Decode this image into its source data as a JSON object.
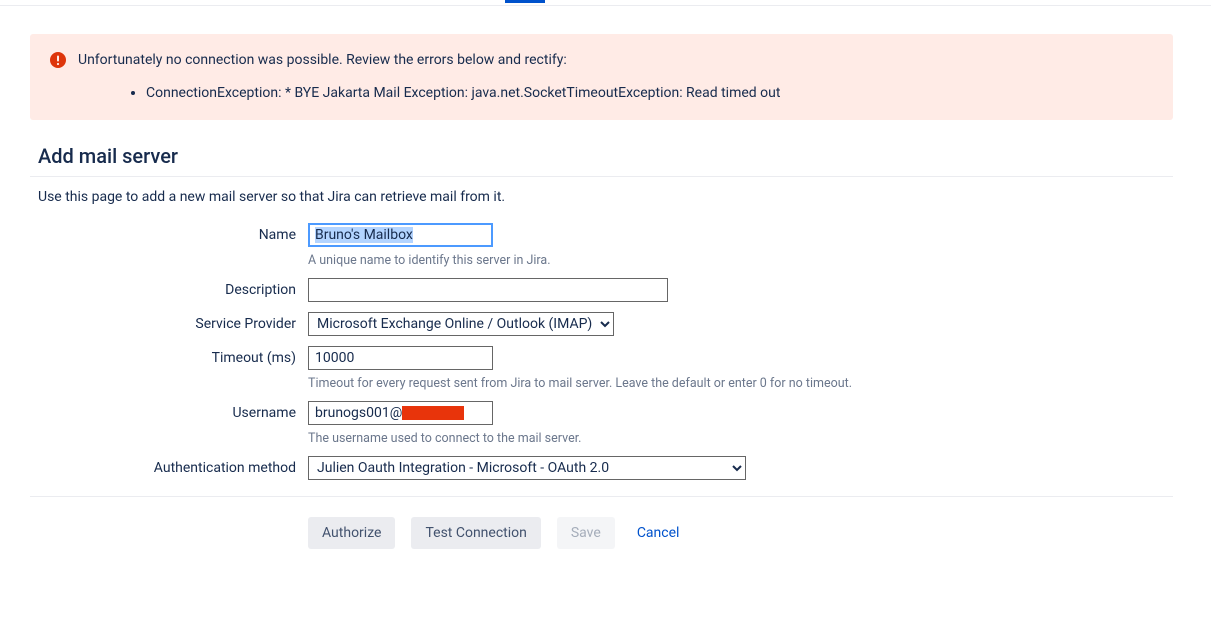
{
  "error": {
    "title": "Unfortunately no connection was possible. Review the errors below and rectify:",
    "items": [
      "ConnectionException: * BYE Jakarta Mail Exception: java.net.SocketTimeoutException: Read timed out"
    ]
  },
  "page": {
    "title": "Add mail server",
    "description": "Use this page to add a new mail server so that Jira can retrieve mail from it."
  },
  "form": {
    "name": {
      "label": "Name",
      "value": "Bruno's Mailbox",
      "help": "A unique name to identify this server in Jira."
    },
    "description": {
      "label": "Description",
      "value": ""
    },
    "service_provider": {
      "label": "Service Provider",
      "value": "Microsoft Exchange Online / Outlook (IMAP)"
    },
    "timeout": {
      "label": "Timeout (ms)",
      "value": "10000",
      "help": "Timeout for every request sent from Jira to mail server. Leave the default or enter 0 for no timeout."
    },
    "username": {
      "label": "Username",
      "value": "brunogs001@",
      "help": "The username used to connect to the mail server."
    },
    "auth_method": {
      "label": "Authentication method",
      "value": "Julien Oauth Integration - Microsoft - OAuth 2.0"
    }
  },
  "buttons": {
    "authorize": "Authorize",
    "test": "Test Connection",
    "save": "Save",
    "cancel": "Cancel"
  }
}
